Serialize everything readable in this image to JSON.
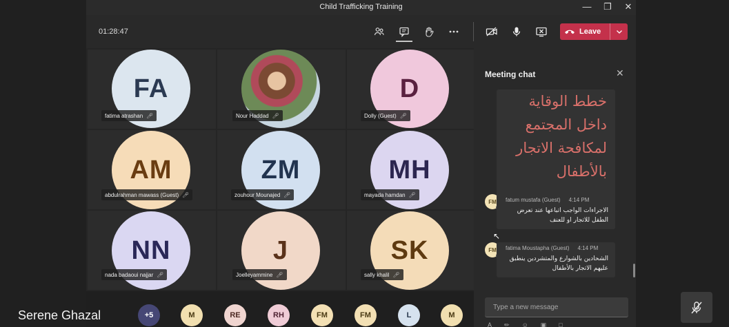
{
  "window": {
    "title": "Child Trafficking Training",
    "minimize": "—",
    "maximize": "❐",
    "close": "✕"
  },
  "toolbar": {
    "timer": "01:28:47",
    "leave_label": "Leave"
  },
  "participants": [
    {
      "initials": "FA",
      "name": "fatima atrashan",
      "bg": "#dce6ef",
      "fg": "#2b3a52"
    },
    {
      "initials": "",
      "name": "Nour Haddad",
      "bg": "photo",
      "fg": "#fff"
    },
    {
      "initials": "D",
      "name": "Dolly (Guest)",
      "bg": "#f0c8dc",
      "fg": "#5a2140"
    },
    {
      "initials": "AM",
      "name": "abdulrahman mawass (Guest)",
      "bg": "#f6dcb8",
      "fg": "#6a3d12"
    },
    {
      "initials": "ZM",
      "name": "zouhour Mounajed",
      "bg": "#d2e0f0",
      "fg": "#22344f"
    },
    {
      "initials": "MH",
      "name": "mayada hamdan",
      "bg": "#dcd6f0",
      "fg": "#2c2650"
    },
    {
      "initials": "NN",
      "name": "nada badaoui najjar",
      "bg": "#dad7f2",
      "fg": "#2a2858"
    },
    {
      "initials": "J",
      "name": "Joelleyammine",
      "bg": "#f1d8c8",
      "fg": "#5a321a"
    },
    {
      "initials": "SK",
      "name": "sally khalil",
      "bg": "#f4dcb8",
      "fg": "#5e3a10"
    }
  ],
  "strip": [
    {
      "label": "+5",
      "bg": "#464775",
      "fg": "#ffffff"
    },
    {
      "label": "M",
      "bg": "#f1dfb0",
      "fg": "#4a3a14"
    },
    {
      "label": "RE",
      "bg": "#f0d5d0",
      "fg": "#4e2a24"
    },
    {
      "label": "RH",
      "bg": "#efccd6",
      "fg": "#4e2232"
    },
    {
      "label": "FM",
      "bg": "#f3e0b4",
      "fg": "#4a3a14"
    },
    {
      "label": "FM",
      "bg": "#f3e0b4",
      "fg": "#4a3a14"
    },
    {
      "label": "L",
      "bg": "#d6e2ee",
      "fg": "#26364a"
    },
    {
      "label": "M",
      "bg": "#f1dfb0",
      "fg": "#4a3a14"
    }
  ],
  "chat": {
    "title": "Meeting chat",
    "big_message": "خطط الوقاية داخل المجتمع لمكافحة الاتجار بالأطفال",
    "messages": [
      {
        "initials": "FM",
        "sender": "fatum mustafa (Guest)",
        "time": "4:14 PM",
        "text": "الاجراءات الواجب اتباعها عند تعرض الطفل للاتجار او للعنف"
      },
      {
        "initials": "FM",
        "sender": "fatima Moustapha (Guest)",
        "time": "4:14 PM",
        "text": "الشحادين بالشوارع والمتشردين ينطبق عليهم الاتجار بالأطفال"
      }
    ],
    "compose_placeholder": "Type a new message"
  },
  "presenter": {
    "name": "Serene Ghazal"
  }
}
